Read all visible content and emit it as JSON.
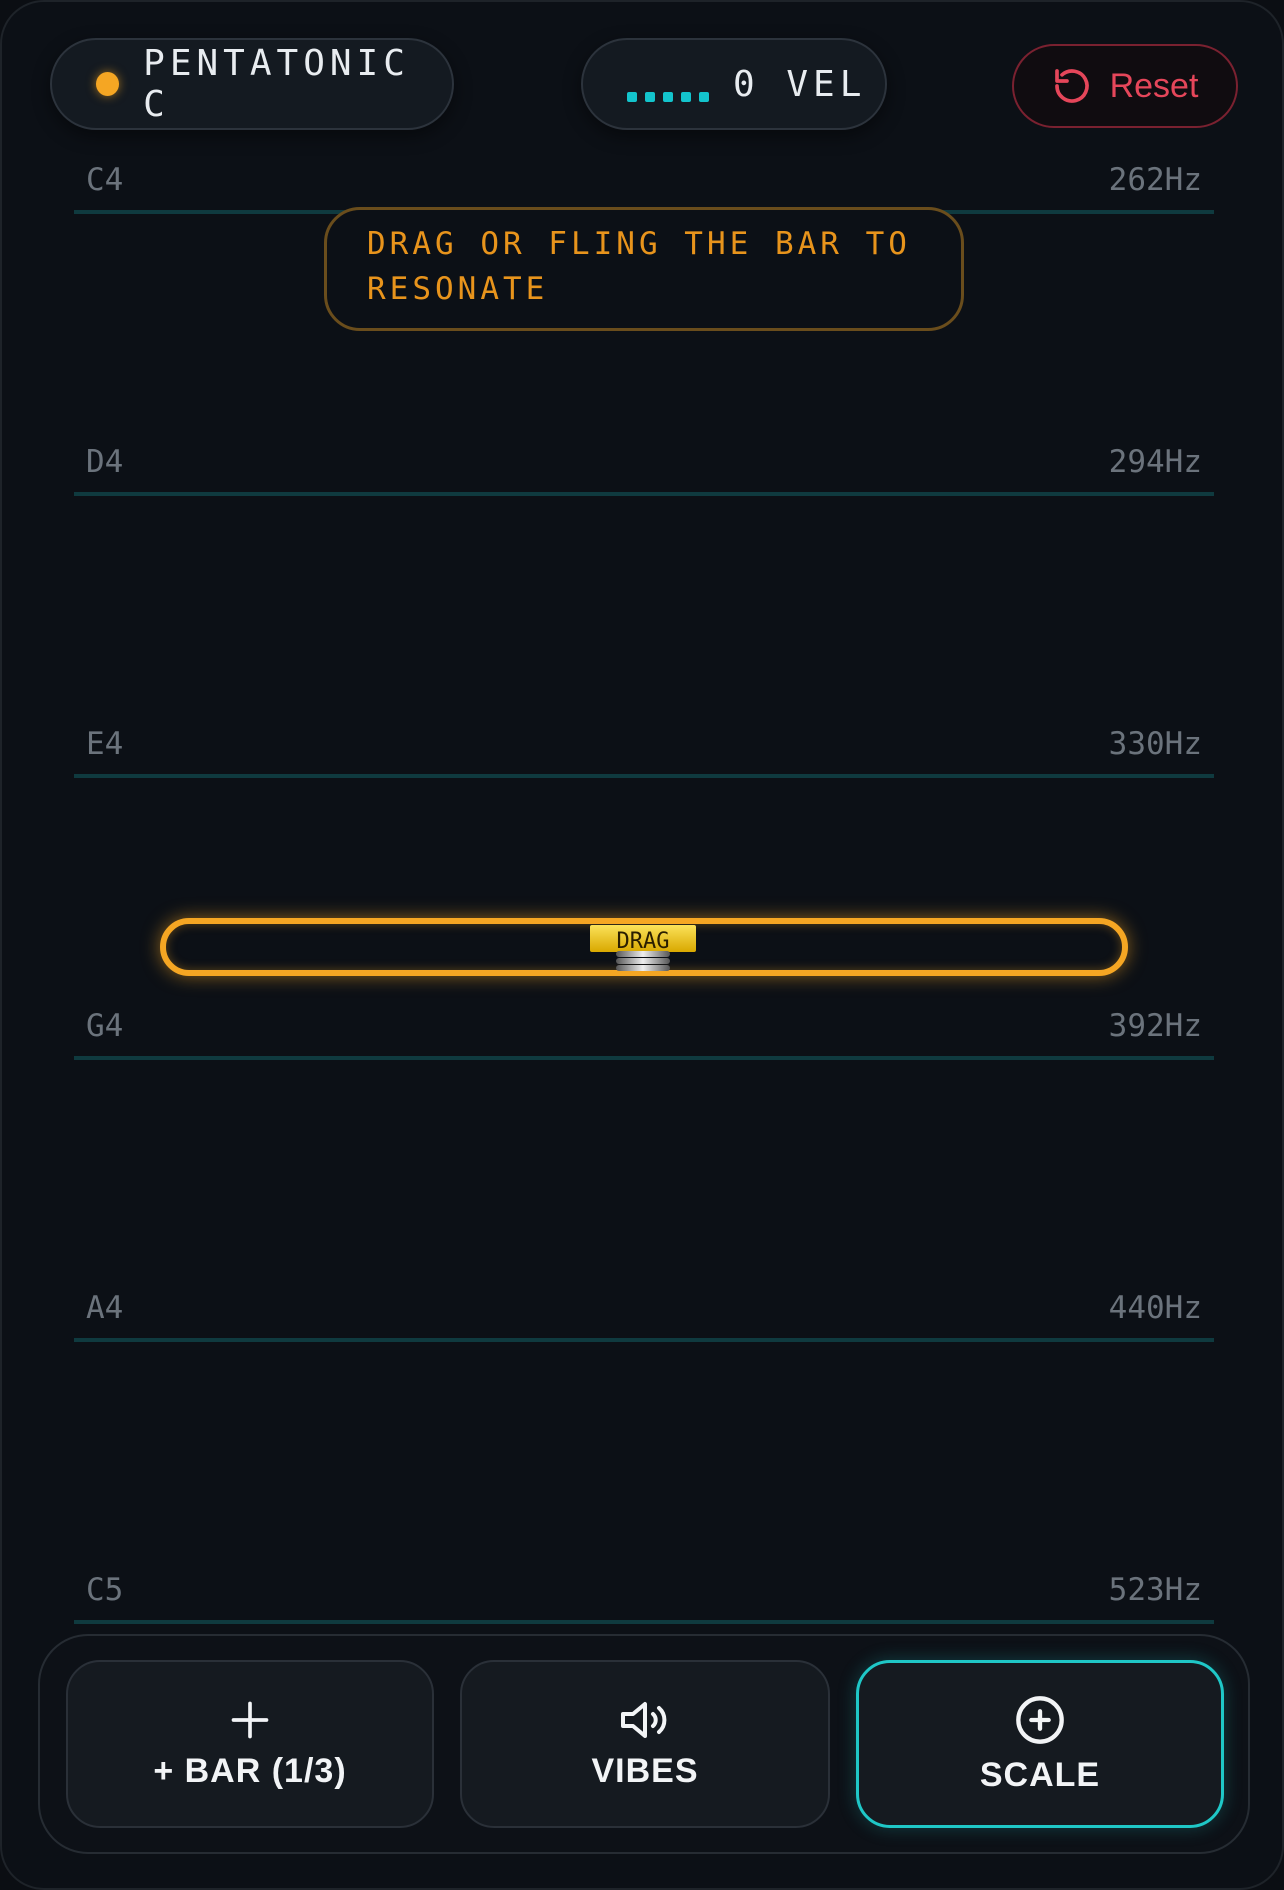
{
  "header": {
    "scale_label": "PENTATONIC C",
    "velocity_label": "0 VEL",
    "reset_label": "Reset"
  },
  "notes": [
    {
      "name": "C4",
      "hz": "262Hz"
    },
    {
      "name": "D4",
      "hz": "294Hz"
    },
    {
      "name": "E4",
      "hz": "330Hz"
    },
    {
      "name": "G4",
      "hz": "392Hz"
    },
    {
      "name": "A4",
      "hz": "440Hz"
    },
    {
      "name": "C5",
      "hz": "523Hz"
    }
  ],
  "tooltip": {
    "text": "DRAG OR FLING THE BAR TO RESONATE"
  },
  "bar": {
    "handle_label": "DRAG"
  },
  "toolbar": {
    "add_bar_label": "+ BAR (1/3)",
    "vibes_label": "VIBES",
    "scale_label": "SCALE"
  },
  "colors": {
    "accent_orange": "#f5a623",
    "accent_teal": "#13c4cc",
    "reset_red": "#e5465a",
    "background": "#0c1016"
  }
}
